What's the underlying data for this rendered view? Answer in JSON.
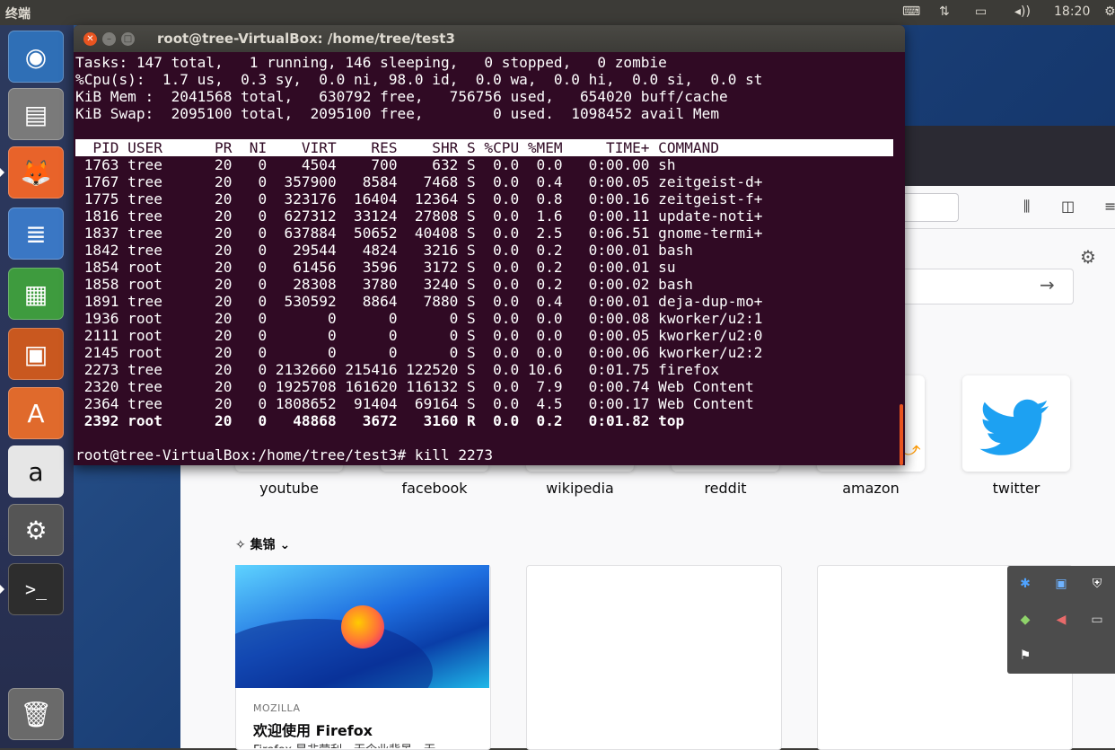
{
  "topbar": {
    "title": "终端",
    "time": "18:20"
  },
  "launcher": {
    "items": [
      {
        "name": "ubuntu-dash",
        "glyph": "◉",
        "bg": "#2f6fb6"
      },
      {
        "name": "files",
        "glyph": "▤",
        "bg": "#7a7a7a"
      },
      {
        "name": "firefox",
        "glyph": "🦊",
        "bg": "#e8632a"
      },
      {
        "name": "writer",
        "glyph": "≣",
        "bg": "#3a77c4"
      },
      {
        "name": "calc",
        "glyph": "▦",
        "bg": "#3e9b3e"
      },
      {
        "name": "impress",
        "glyph": "▣",
        "bg": "#c9581f"
      },
      {
        "name": "software",
        "glyph": "A",
        "bg": "#e06a2c"
      },
      {
        "name": "amazon",
        "glyph": "a",
        "bg": "#e6e6e6"
      },
      {
        "name": "settings",
        "glyph": "⚙",
        "bg": "#555555"
      },
      {
        "name": "terminal",
        "glyph": ">_",
        "bg": "#2d2d2d"
      },
      {
        "name": "trash",
        "glyph": "🗑",
        "bg": "#6a6a6a"
      }
    ]
  },
  "terminal": {
    "title": "root@tree-VirtualBox: /home/tree/test3",
    "summary": [
      "Tasks: 147 total,   1 running, 146 sleeping,   0 stopped,   0 zombie",
      "%Cpu(s):  1.7 us,  0.3 sy,  0.0 ni, 98.0 id,  0.0 wa,  0.0 hi,  0.0 si,  0.0 st",
      "KiB Mem :  2041568 total,   630792 free,   756756 used,   654020 buff/cache",
      "KiB Swap:  2095100 total,  2095100 free,        0 used.  1098452 avail Mem"
    ],
    "header": "  PID USER      PR  NI    VIRT    RES    SHR S %CPU %MEM     TIME+ COMMAND",
    "processes": [
      " 1763 tree      20   0    4504    700    632 S  0.0  0.0   0:00.00 sh",
      " 1767 tree      20   0  357900   8584   7468 S  0.0  0.4   0:00.05 zeitgeist-d+",
      " 1775 tree      20   0  323176  16404  12364 S  0.0  0.8   0:00.16 zeitgeist-f+",
      " 1816 tree      20   0  627312  33124  27808 S  0.0  1.6   0:00.11 update-noti+",
      " 1837 tree      20   0  637884  50652  40408 S  0.0  2.5   0:06.51 gnome-termi+",
      " 1842 tree      20   0   29544   4824   3216 S  0.0  0.2   0:00.01 bash",
      " 1854 root      20   0   61456   3596   3172 S  0.0  0.2   0:00.01 su",
      " 1858 root      20   0   28308   3780   3240 S  0.0  0.2   0:00.02 bash",
      " 1891 tree      20   0  530592   8864   7880 S  0.0  0.4   0:00.01 deja-dup-mo+",
      " 1936 root      20   0       0      0      0 S  0.0  0.0   0:00.08 kworker/u2:1",
      " 2111 root      20   0       0      0      0 S  0.0  0.0   0:00.05 kworker/u2:0",
      " 2145 root      20   0       0      0      0 S  0.0  0.0   0:00.06 kworker/u2:2",
      " 2273 tree      20   0 2132660 215416 122520 S  0.0 10.6   0:01.75 firefox",
      " 2320 tree      20   0 1925708 161620 116132 S  0.0  7.9   0:00.74 Web Content",
      " 2364 tree      20   0 1808652  91404  69164 S  0.0  4.5   0:00.17 Web Content",
      " 2392 root      20   0   48868   3672   3160 R  0.0  0.2   0:01.82 top"
    ],
    "prompt": "root@tree-VirtualBox:/home/tree/test3# kill 2273"
  },
  "firefox": {
    "sites": [
      "youtube",
      "facebook",
      "wikipedia",
      "reddit",
      "amazon",
      "twitter"
    ],
    "pocket_label": "集锦",
    "card": {
      "source": "MOZILLA",
      "title": "欢迎使用 Firefox",
      "desc": "Firefox 是非营利，无企业背景，无"
    }
  },
  "colors": {
    "terminal_bg": "#300a24",
    "accent": "#e95420",
    "twitter": "#1da1f2"
  }
}
